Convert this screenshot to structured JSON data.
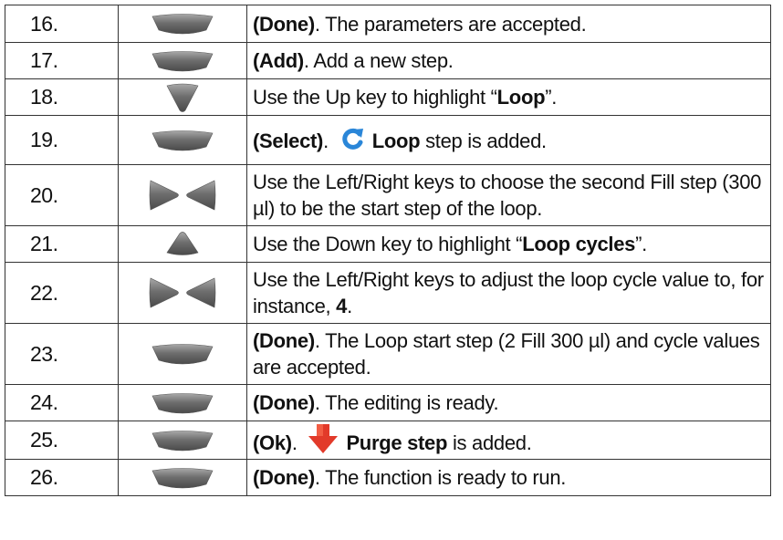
{
  "rows": [
    {
      "num": "16.",
      "key": "softkey",
      "parts": [
        {
          "t": "(Done)",
          "b": true
        },
        {
          "t": ". The parameters are accepted."
        }
      ]
    },
    {
      "num": "17.",
      "key": "softkey",
      "parts": [
        {
          "t": "(Add)",
          "b": true
        },
        {
          "t": ". Add a new step."
        }
      ]
    },
    {
      "num": "18.",
      "key": "up",
      "parts": [
        {
          "t": "Use the Up key to highlight “"
        },
        {
          "t": "Loop",
          "b": true
        },
        {
          "t": "”."
        }
      ]
    },
    {
      "num": "19.",
      "key": "softkey",
      "icon": "loop-arrow-icon",
      "parts": [
        {
          "t": "(Select)",
          "b": true
        },
        {
          "t": ". "
        },
        {
          "t": "Loop",
          "b": true
        },
        {
          "t": " step is added."
        }
      ]
    },
    {
      "num": "20.",
      "key": "leftright",
      "parts": [
        {
          "t": "Use the Left/Right keys to choose the second Fill step (300 µl) to be the start step of the loop."
        }
      ]
    },
    {
      "num": "21.",
      "key": "down",
      "parts": [
        {
          "t": "Use the Down key to highlight “"
        },
        {
          "t": "Loop cycles",
          "b": true
        },
        {
          "t": "”."
        }
      ]
    },
    {
      "num": "22.",
      "key": "leftright",
      "parts": [
        {
          "t": "Use the Left/Right keys to adjust the loop cycle value to, for instance, "
        },
        {
          "t": "4",
          "b": true
        },
        {
          "t": "."
        }
      ]
    },
    {
      "num": "23.",
      "key": "softkey",
      "parts": [
        {
          "t": "(Done)",
          "b": true
        },
        {
          "t": ". The Loop start step (2 Fill 300 µl) and cycle values are accepted."
        }
      ]
    },
    {
      "num": "24.",
      "key": "softkey",
      "parts": [
        {
          "t": "(Done)",
          "b": true
        },
        {
          "t": ". The editing is ready."
        }
      ]
    },
    {
      "num": "25.",
      "key": "softkey",
      "icon": "red-down-arrow-icon",
      "parts": [
        {
          "t": "(Ok)",
          "b": true
        },
        {
          "t": ". "
        },
        {
          "t": "Purge step",
          "b": true
        },
        {
          "t": " is added."
        }
      ]
    },
    {
      "num": "26.",
      "key": "softkey",
      "parts": [
        {
          "t": "(Done)",
          "b": true
        },
        {
          "t": ". The function is ready to run."
        }
      ]
    }
  ],
  "colors": {
    "key_gray": "#6e6e6e",
    "key_gray_light": "#a8a8a8",
    "loop_blue": "#2a86d8",
    "purge_red": "#e23a2a",
    "border": "#333333"
  }
}
